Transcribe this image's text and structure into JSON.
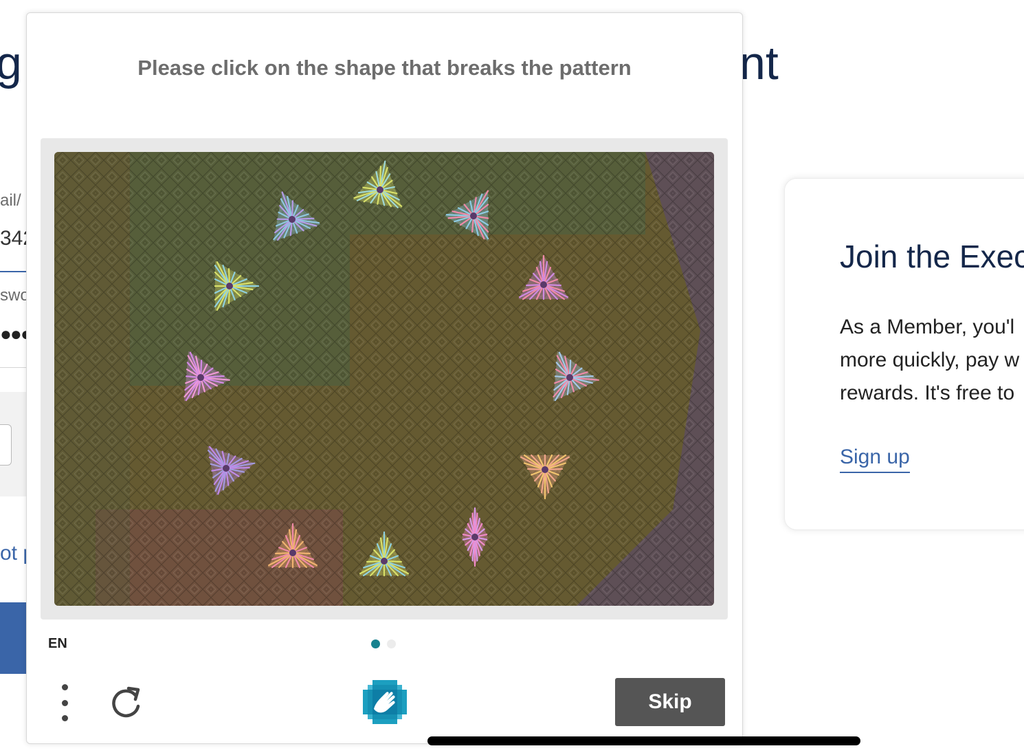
{
  "background": {
    "heading_left": "g",
    "heading_right": "nt",
    "email_label": "ail/",
    "email_value": "342",
    "password_label": "swo",
    "password_value": "●●●",
    "forgot_link": "ot p",
    "join_card": {
      "title": "Join the Exec",
      "text_lines": [
        "As a Member, you'l",
        "more quickly, pay w",
        "rewards. It's free to"
      ],
      "signup_link": "Sign up"
    }
  },
  "captcha": {
    "prompt": "Please click on the shape that breaks the pattern",
    "language": "EN",
    "pages": {
      "current": 1,
      "total": 2
    },
    "skip_label": "Skip",
    "logo_icon": "hand-wave-icon",
    "menu_icon": "more-vertical-icon",
    "refresh_icon": "refresh-icon",
    "accent_color": "#17828f",
    "button_color": "#555555"
  }
}
